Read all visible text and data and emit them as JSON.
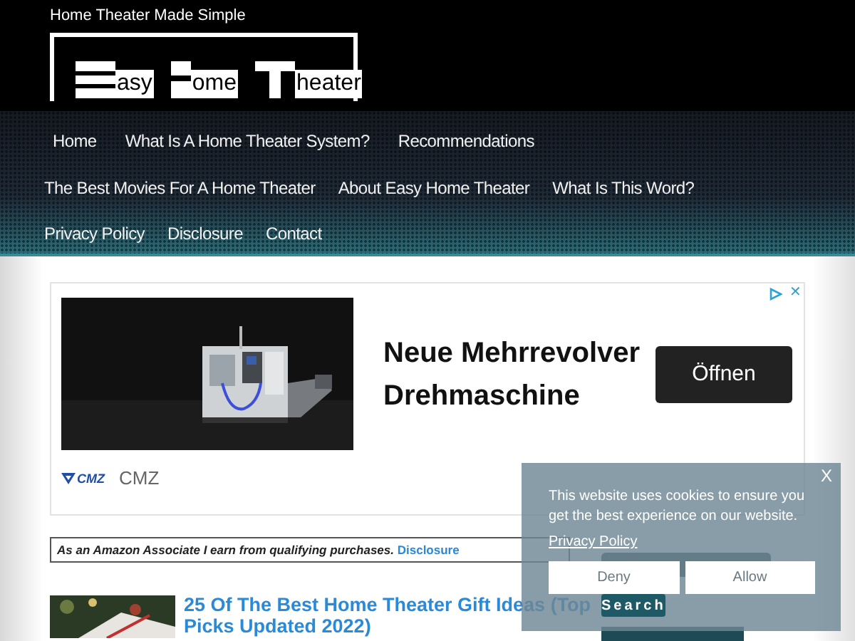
{
  "header": {
    "tagline": "Home Theater Made Simple",
    "logo_words": [
      "asy",
      "ome",
      "heater"
    ]
  },
  "nav": {
    "rows": [
      [
        "Home",
        "What Is A Home Theater System?",
        "Recommendations"
      ],
      [
        "The Best Movies For A Home Theater",
        "About Easy Home Theater",
        "What Is This Word?"
      ],
      [
        "Privacy Policy",
        "Disclosure",
        "Contact"
      ]
    ]
  },
  "ad": {
    "headline": "Neue Mehrrevolver Drehmaschine",
    "button": "Öffnen",
    "logo_text": "CMZ",
    "advertiser": "CMZ",
    "close": "✕"
  },
  "disclosure": {
    "text": "As an Amazon Associate I earn from qualifying purchases.",
    "link": "Disclosure"
  },
  "posts": [
    {
      "title": "25 Of The Best Home Theater Gift Ideas (Top Picks Updated 2022)"
    }
  ],
  "sidebar": {
    "search_button": "Search"
  },
  "cookie": {
    "close": "X",
    "message": "This website uses cookies to ensure you get the best experience on our website.",
    "link": "Privacy Policy",
    "buttons": [
      "Deny",
      "Allow"
    ]
  }
}
